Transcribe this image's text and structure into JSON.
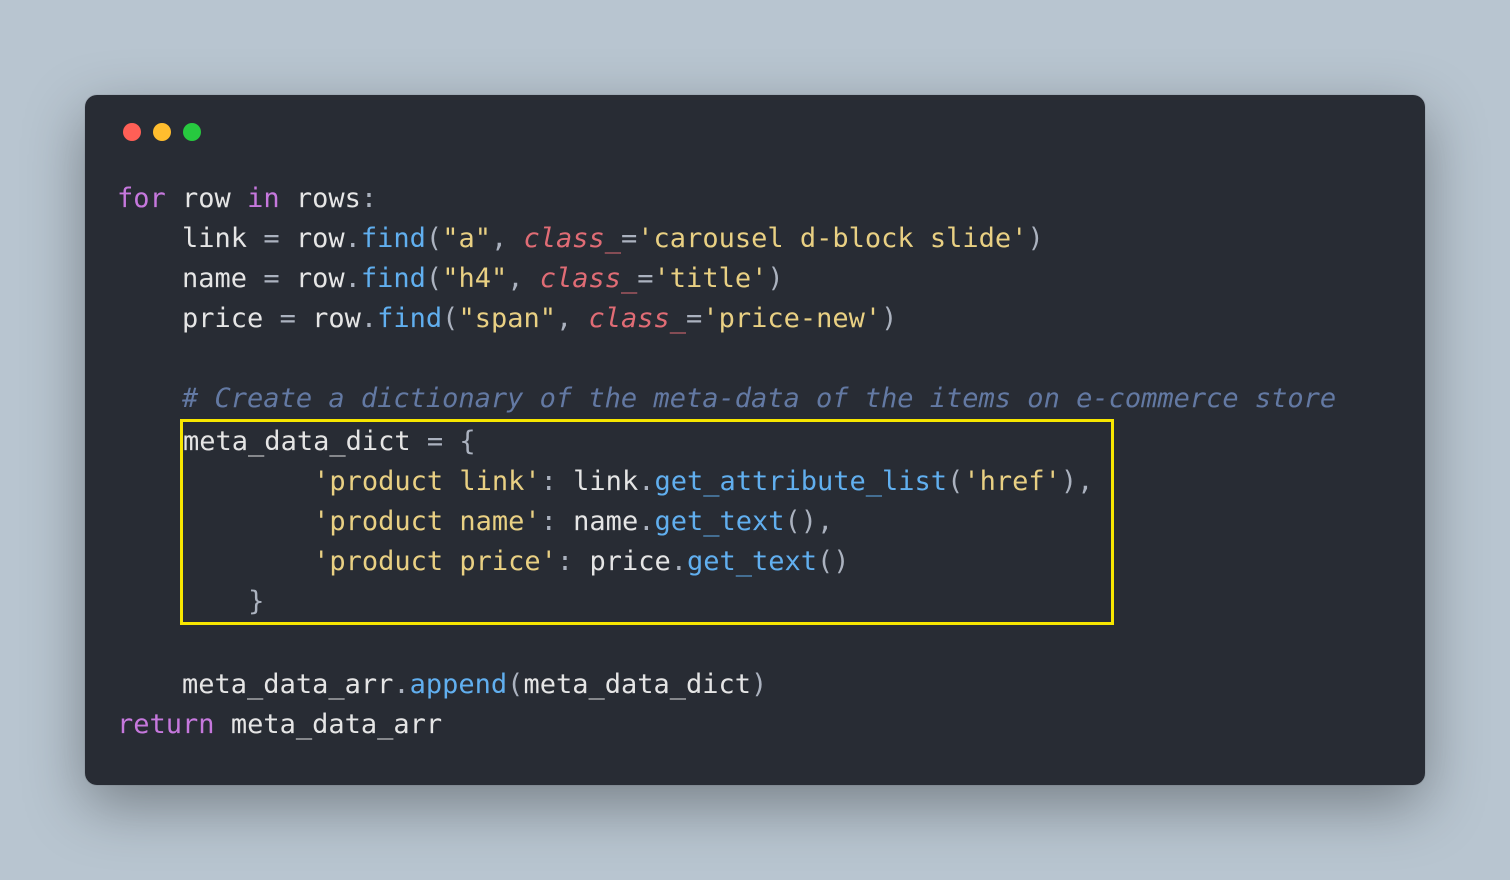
{
  "code": {
    "l1": {
      "kw1": "for",
      "id1": "row",
      "kw2": "in",
      "id2": "rows",
      "p1": ":"
    },
    "l2": {
      "lhs": "link",
      "eq": " = ",
      "obj": "row",
      "dot": ".",
      "fn": "find",
      "lp": "(",
      "s1": "\"a\"",
      "c": ", ",
      "arg": "class_",
      "eqs": "=",
      "s2": "'carousel d-block slide'",
      "rp": ")"
    },
    "l3": {
      "lhs": "name",
      "eq": " = ",
      "obj": "row",
      "dot": ".",
      "fn": "find",
      "lp": "(",
      "s1": "\"h4\"",
      "c": ", ",
      "arg": "class_",
      "eqs": "=",
      "s2": "'title'",
      "rp": ")"
    },
    "l4": {
      "lhs": "price",
      "eq": " = ",
      "obj": "row",
      "dot": ".",
      "fn": "find",
      "lp": "(",
      "s1": "\"span\"",
      "c": ", ",
      "arg": "class_",
      "eqs": "=",
      "s2": "'price-new'",
      "rp": ")"
    },
    "comment": "# Create a dictionary of the meta-data of the items on e-commerce store",
    "dict": {
      "head": {
        "lhs": "meta_data_dict",
        "eq": " = {"
      },
      "r1": {
        "k": "'product link'",
        "c": ": ",
        "obj": "link",
        "dot": ".",
        "fn": "get_attribute_list",
        "lp": "(",
        "s": "'href'",
        "rp": "),"
      },
      "r2": {
        "k": "'product name'",
        "c": ": ",
        "obj": "name",
        "dot": ".",
        "fn": "get_text",
        "lp": "(",
        "rp": "),"
      },
      "r3": {
        "k": "'product price'",
        "c": ": ",
        "obj": "price",
        "dot": ".",
        "fn": "get_text",
        "lp": "(",
        "rp": ")"
      },
      "close": "}"
    },
    "append": {
      "obj": "meta_data_arr",
      "dot": ".",
      "fn": "append",
      "lp": "(",
      "arg": "meta_data_dict",
      "rp": ")"
    },
    "ret": {
      "kw": "return",
      "sp": " ",
      "id": "meta_data_arr"
    }
  }
}
